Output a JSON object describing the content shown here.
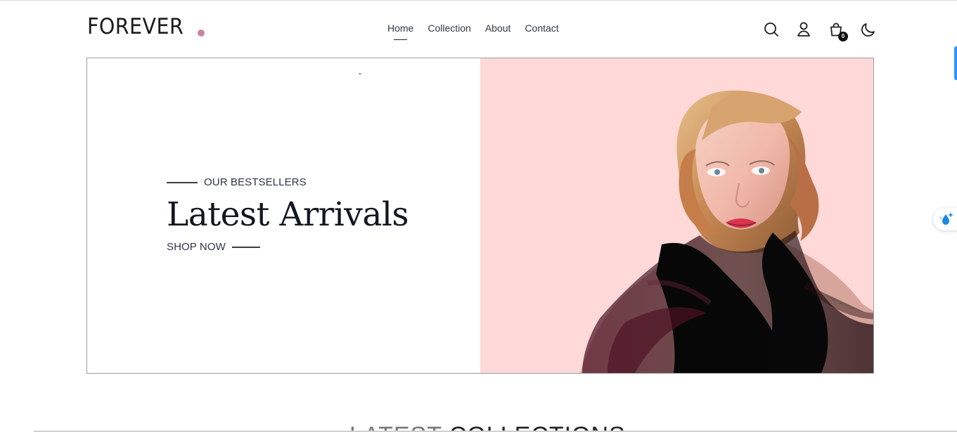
{
  "brand": {
    "name": "FOREVER",
    "dot_color": "#c586a5"
  },
  "navigation": {
    "links": [
      {
        "label": "Home",
        "active": true
      },
      {
        "label": "Collection",
        "active": false
      },
      {
        "label": "About",
        "active": false
      },
      {
        "label": "Contact",
        "active": false
      }
    ]
  },
  "header_icons": {
    "search": "search-icon",
    "profile": "user-icon",
    "cart": "shopping-bag-icon",
    "theme": "moon-icon",
    "cart_count": "0"
  },
  "hero": {
    "eyebrow": "OUR BESTSELLERS",
    "title": "Latest Arrivals",
    "cta": "SHOP NOW",
    "image_description": "model-with-blonde-hair-and-black-scarf",
    "image_background": "#ffd8d8"
  },
  "section_peek": {
    "title_light": "LATEST ",
    "title_bold": "COLLECTIONS"
  },
  "floating_tool": {
    "icon": "water-drop-sparkle-icon"
  }
}
